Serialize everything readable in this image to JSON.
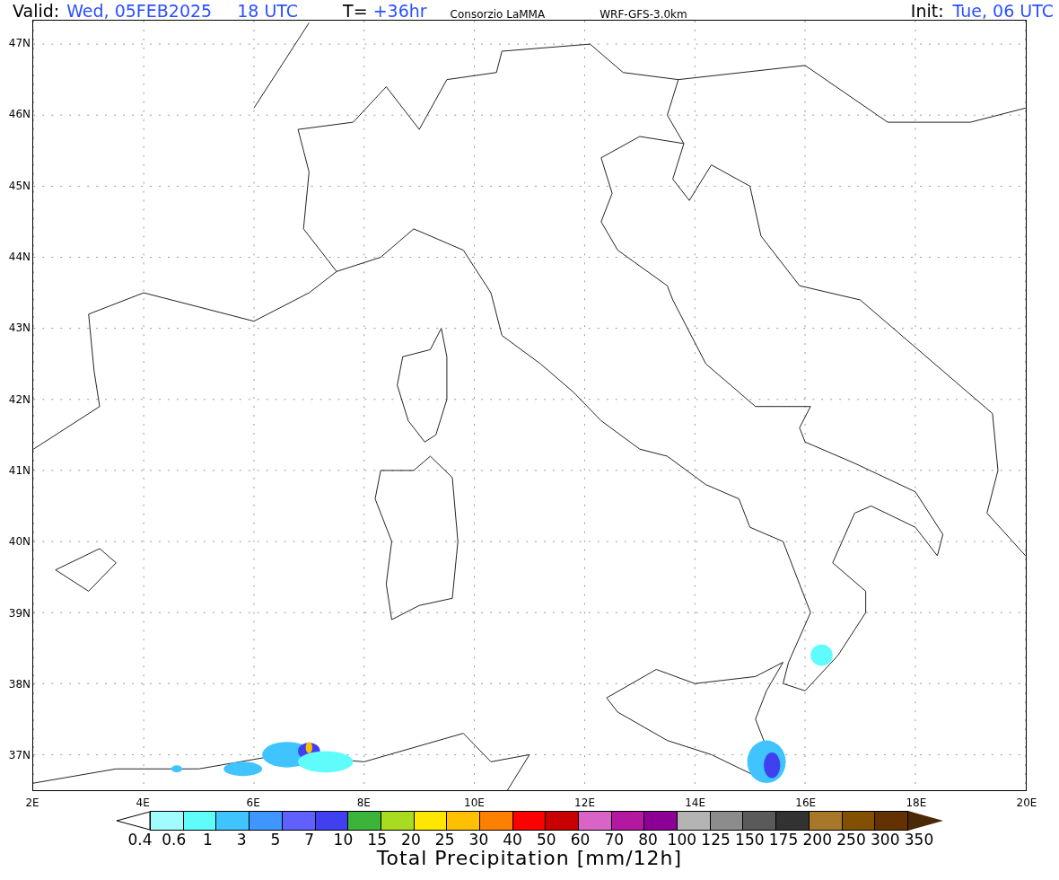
{
  "header": {
    "valid_label": "Valid:",
    "valid_date": "Wed, 05FEB2025",
    "valid_time": "18 UTC",
    "step_label": "T=",
    "step_value": "+36hr",
    "source": "Consorzio LaMMA",
    "model": "WRF-GFS-3.0km",
    "init_label": "Init:",
    "init_value": "Tue, 06 UTC"
  },
  "map": {
    "lat_labels": [
      "47N",
      "46N",
      "45N",
      "44N",
      "43N",
      "42N",
      "41N",
      "40N",
      "39N",
      "38N",
      "37N"
    ],
    "lon_labels": [
      "2E",
      "4E",
      "6E",
      "8E",
      "10E",
      "12E",
      "14E",
      "16E",
      "18E",
      "20E"
    ]
  },
  "legend": {
    "title": "Total Precipitation [mm/12h]",
    "labels": [
      "0.4",
      "0.6",
      "1",
      "3",
      "5",
      "7",
      "10",
      "15",
      "20",
      "25",
      "30",
      "40",
      "50",
      "60",
      "70",
      "80",
      "100",
      "125",
      "150",
      "175",
      "200",
      "250",
      "300",
      "350"
    ],
    "swatches": [
      {
        "color": "#a0fcff"
      },
      {
        "color": "#60fcfc"
      },
      {
        "color": "#40c4ff"
      },
      {
        "color": "#4096ff"
      },
      {
        "color": "#6060ff"
      },
      {
        "color": "#4040f0"
      },
      {
        "color": "#3cb43c"
      },
      {
        "color": "#a8dc20"
      },
      {
        "color": "#ffe600"
      },
      {
        "color": "#ffc000"
      },
      {
        "color": "#ff8000"
      },
      {
        "color": "#ff0000"
      },
      {
        "color": "#c80000"
      },
      {
        "color": "#d864c8"
      },
      {
        "color": "#b418a0"
      },
      {
        "color": "#8c0096"
      },
      {
        "color": "#b4b4b4"
      },
      {
        "color": "#8c8c8c"
      },
      {
        "color": "#5a5a5a"
      },
      {
        "color": "#323232"
      },
      {
        "color": "#a87828"
      },
      {
        "color": "#825000"
      },
      {
        "color": "#643200"
      }
    ],
    "over_arrow": {
      "color": "#4b2808"
    }
  }
}
